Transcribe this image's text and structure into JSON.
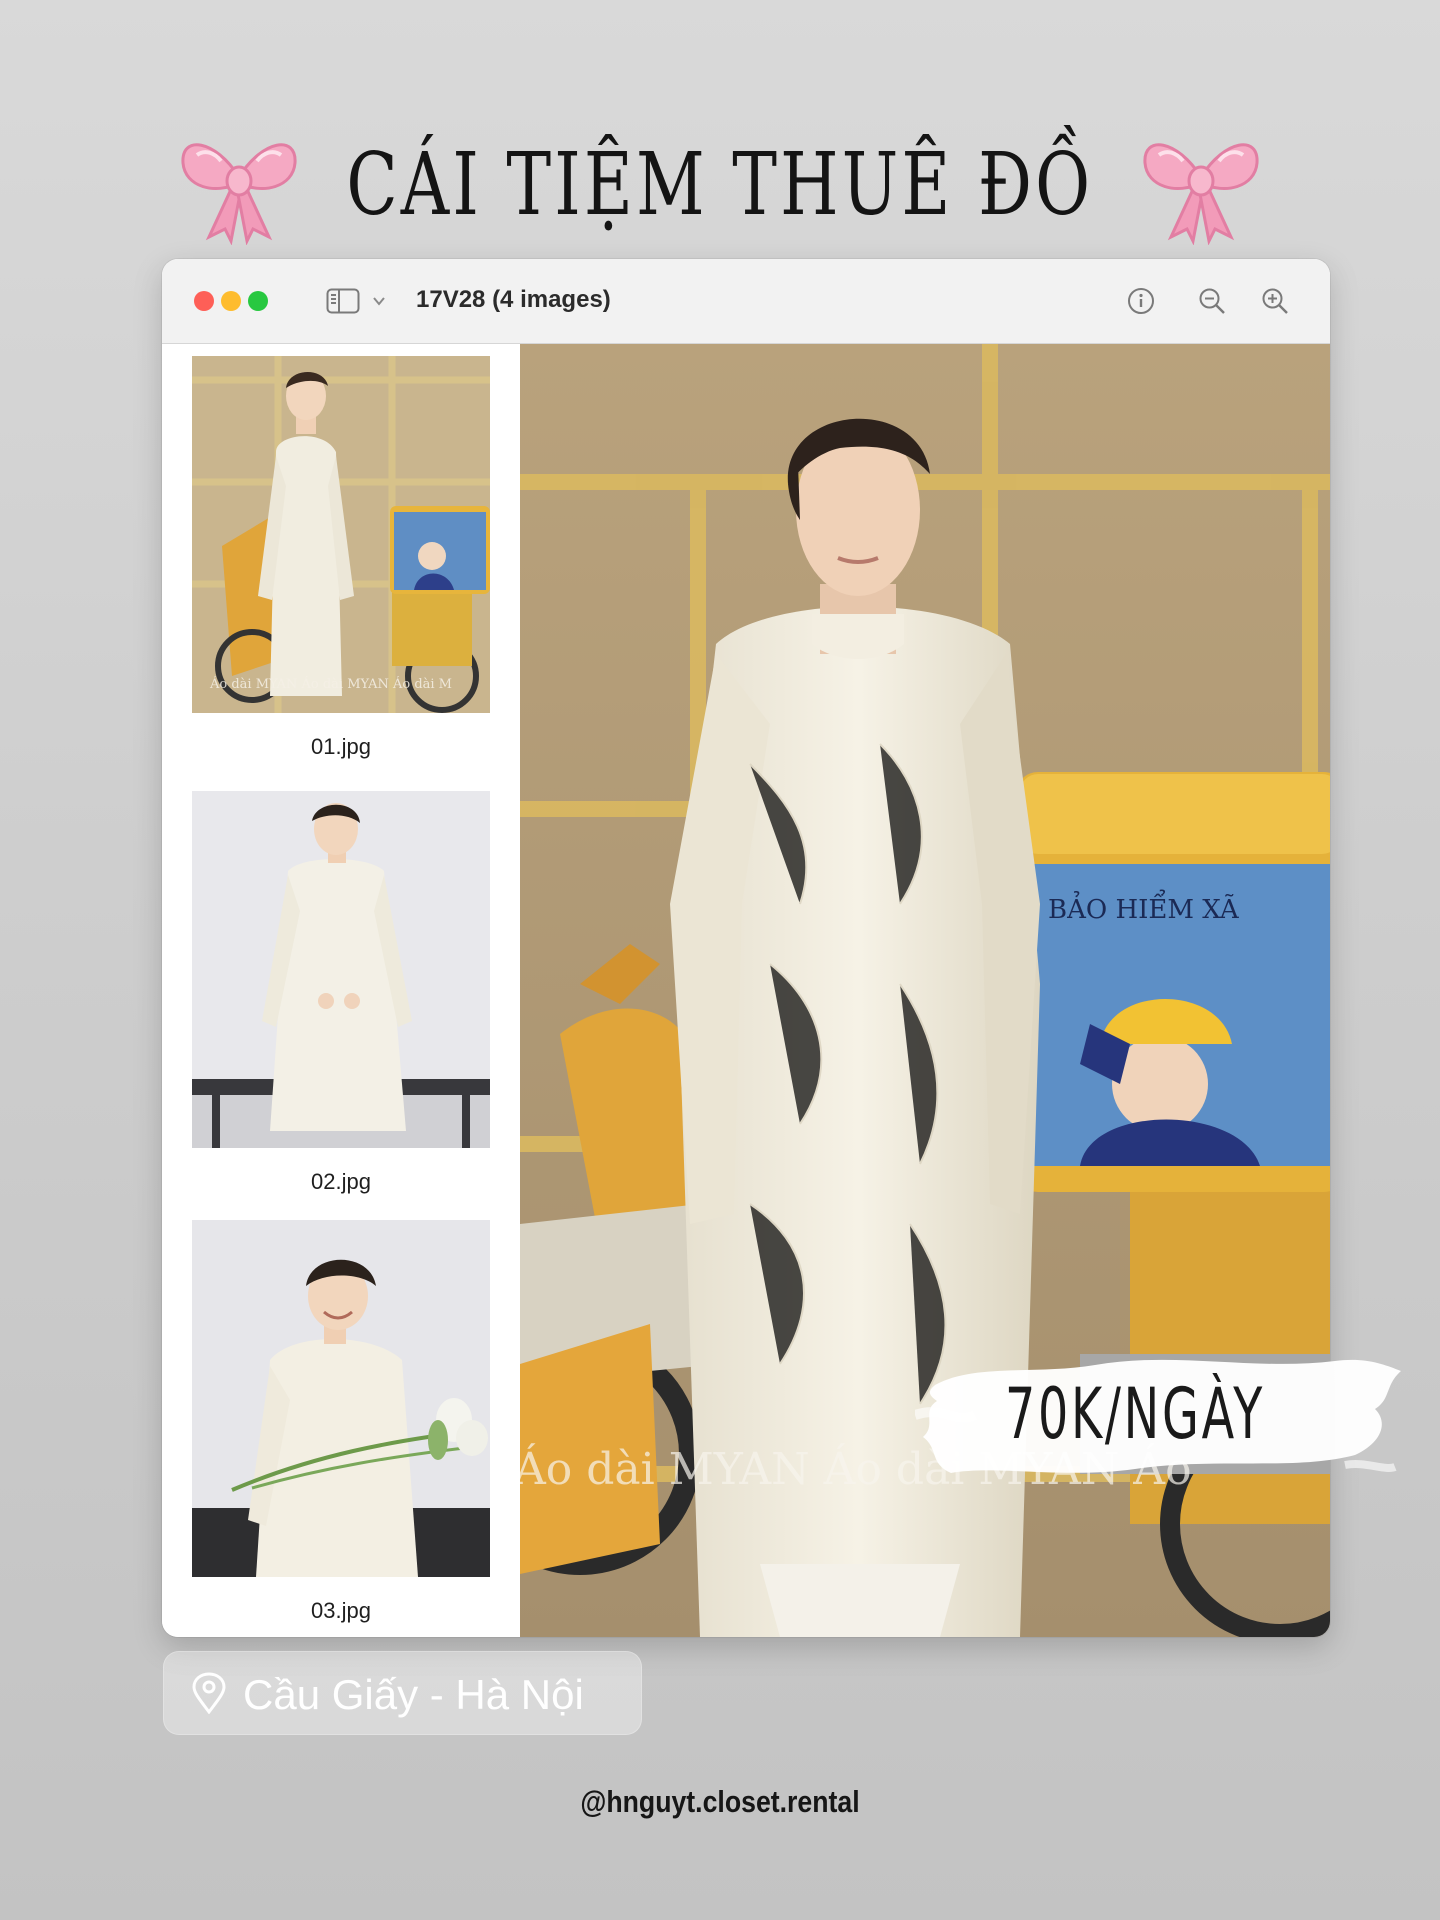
{
  "header": {
    "title": "CÁI TIỆM THUÊ ĐỒ",
    "left_decoration": "bow-icon",
    "right_decoration": "bow-icon"
  },
  "window": {
    "title": "17V28 (4 images)",
    "toolbar": {
      "sidebar_toggle": "sidebar-icon",
      "info": "info-icon",
      "zoom_out": "zoom-out-icon",
      "zoom_in": "zoom-in-icon"
    },
    "traffic_lights": {
      "close": "#fe5f57",
      "minimize": "#febc2e",
      "zoom": "#28c840"
    },
    "sidebar": {
      "items": [
        {
          "label": "01.jpg"
        },
        {
          "label": "02.jpg"
        },
        {
          "label": "03.jpg"
        }
      ]
    },
    "main_image": {
      "watermark": "Áo dài MYAN    Áo dài MYAN    Áo",
      "box_text": "BẢO HIỂM XÃ"
    }
  },
  "thumb_watermark": "Áo dài MYAN   Áo dài MYAN   Áo dài M",
  "price": "70K/NGÀY",
  "location": {
    "icon": "map-pin-icon",
    "text": "Cầu Giấy - Hà Nội"
  },
  "footer": {
    "handle": "@hnguyt.closet.rental"
  }
}
